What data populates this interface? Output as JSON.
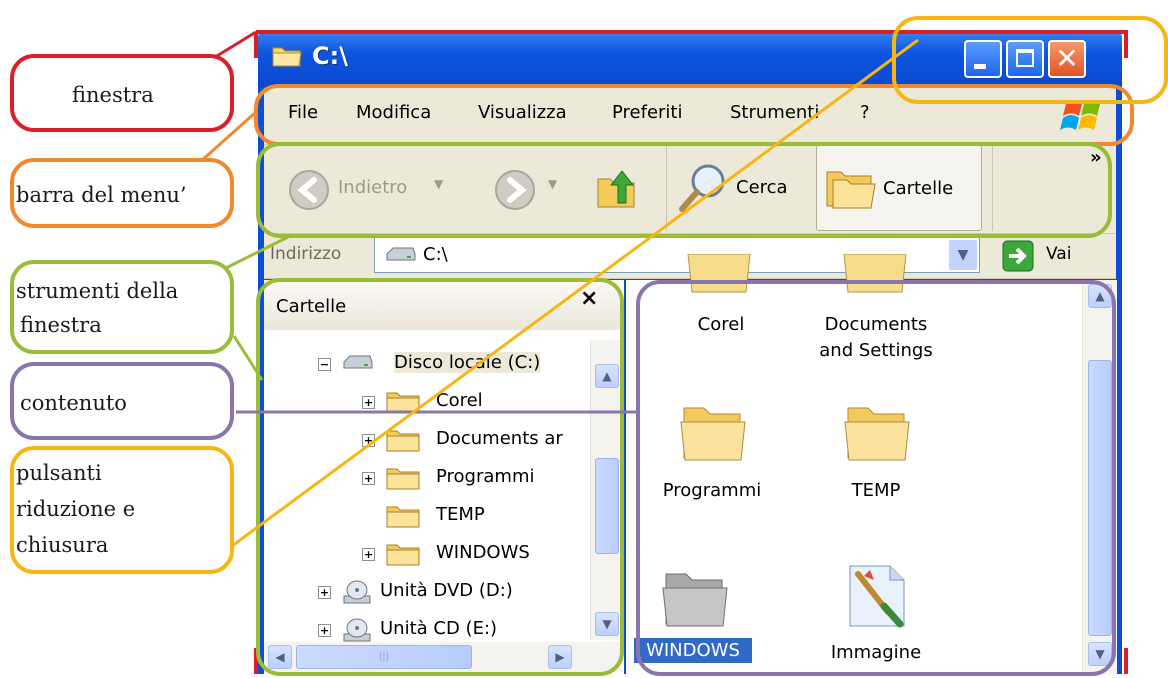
{
  "window": {
    "title": "C:\\",
    "controls": {
      "minimize": "minimize",
      "maximize": "maximize",
      "close": "✕"
    }
  },
  "menubar": {
    "items": [
      "File",
      "Modifica",
      "Visualizza",
      "Preferiti",
      "Strumenti",
      "?"
    ]
  },
  "toolbar": {
    "back_label": "Indietro",
    "search_label": "Cerca",
    "folders_label": "Cartelle",
    "more": "»"
  },
  "addressbar": {
    "label": "Indirizzo",
    "value": "C:\\",
    "go_label": "Vai"
  },
  "folders_pane": {
    "title": "Cartelle",
    "close": "×",
    "tree": [
      {
        "label": "Disco locale (C:)",
        "expander": "−"
      },
      {
        "label": "Corel",
        "expander": "+"
      },
      {
        "label": "Documents ar",
        "expander": "+"
      },
      {
        "label": "Programmi",
        "expander": "+"
      },
      {
        "label": "TEMP",
        "expander": ""
      },
      {
        "label": "WINDOWS",
        "expander": "+"
      },
      {
        "label": "Unità DVD (D:)",
        "expander": "+"
      },
      {
        "label": "Unità CD (E:)",
        "expander": "+"
      }
    ],
    "scroll_grip": "|||"
  },
  "content": {
    "items": [
      {
        "label": "Corel",
        "label2": ""
      },
      {
        "label": "Documents",
        "label2": "and Settings"
      },
      {
        "label": "Programmi",
        "label2": ""
      },
      {
        "label": "TEMP",
        "label2": ""
      },
      {
        "label": "WINDOWS",
        "label2": ""
      },
      {
        "label": "Immagine",
        "label2": ""
      }
    ]
  },
  "callouts": {
    "finestra": "finestra",
    "barra": "barra del menu’",
    "strumenti": [
      "strumenti della",
      "finestra"
    ],
    "contenuto": "contenuto",
    "pulsanti": [
      "pulsanti",
      "riduzione e",
      "chiusura"
    ]
  },
  "colors": {
    "red": "#d8202a",
    "orange": "#f0892e",
    "green": "#9bbb3a",
    "purple": "#8b76ab",
    "gold": "#f7b614",
    "xp_blue": "#0b4fd6"
  }
}
